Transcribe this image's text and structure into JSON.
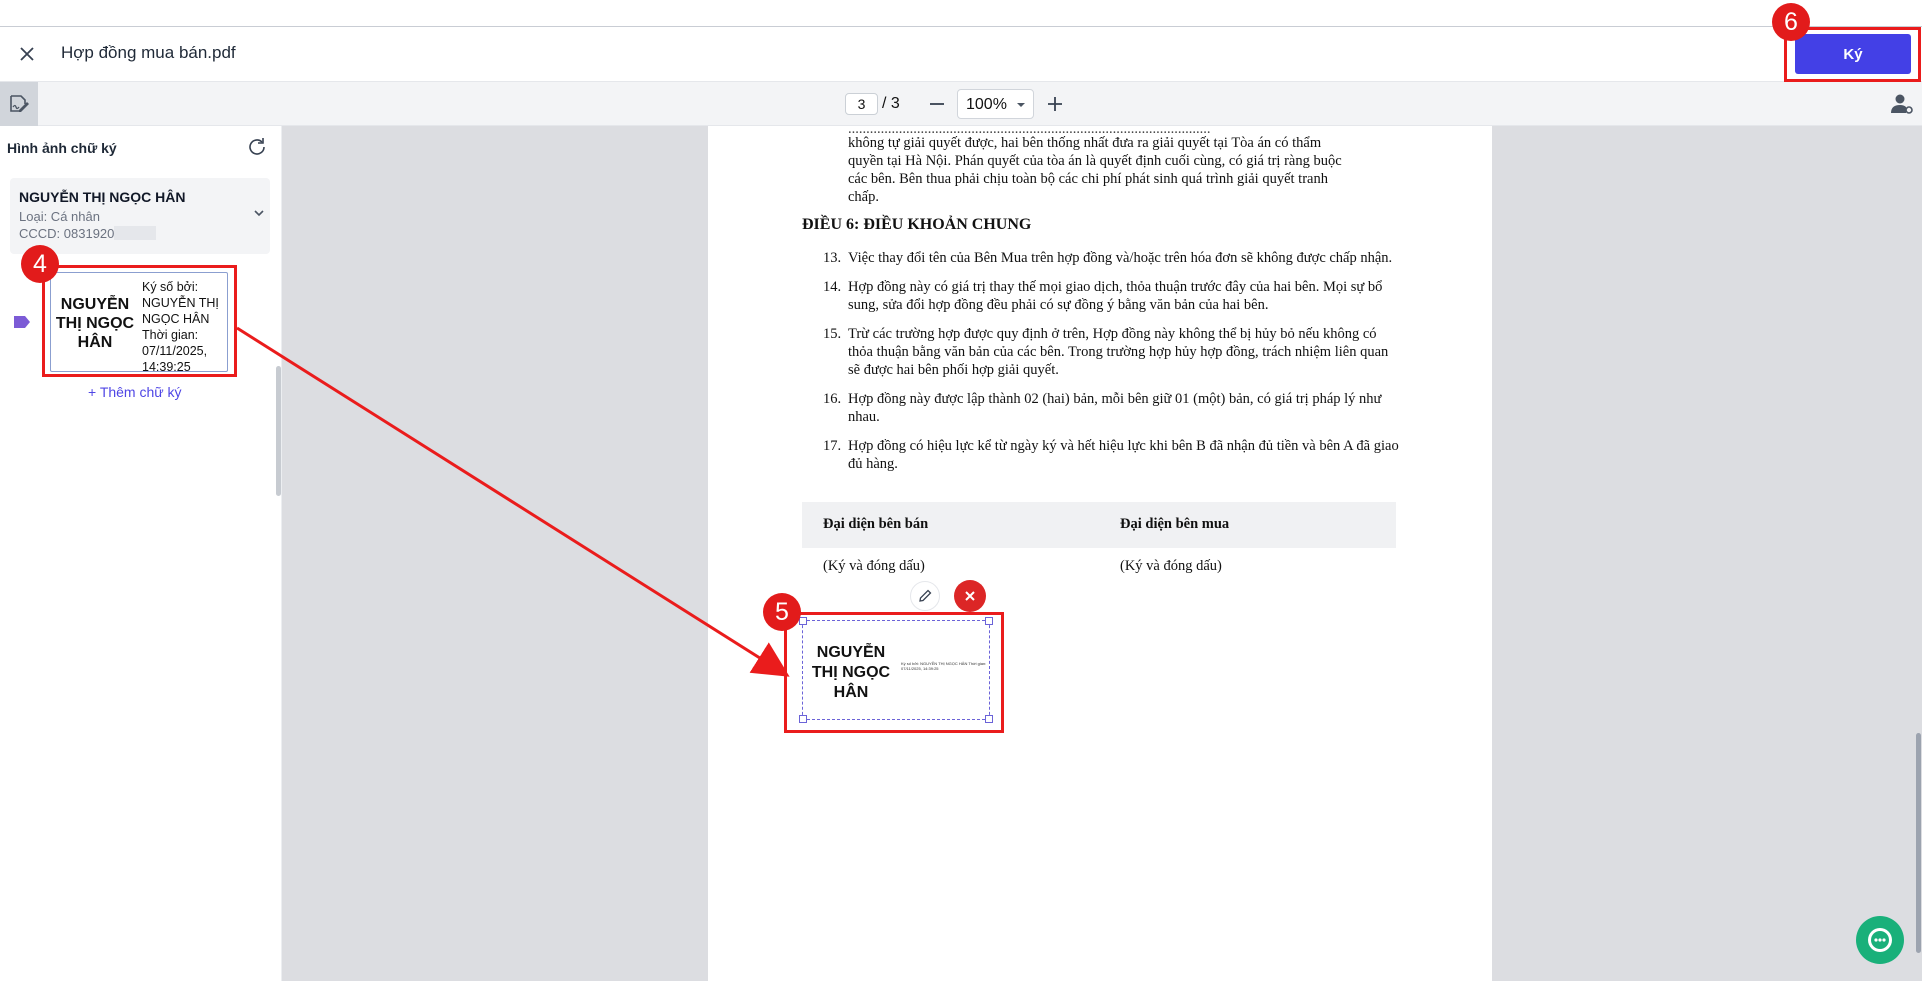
{
  "header": {
    "title": "Hợp đồng mua bán.pdf",
    "sign_label": "Ký"
  },
  "toolbar": {
    "current_page": "3",
    "total_pages": "/ 3",
    "zoom": "100%"
  },
  "sidebar": {
    "title": "Hình ảnh chữ ký",
    "signer": {
      "name": "NGUYỄN THỊ NGỌC HÂN",
      "type": "Loại: Cá nhân",
      "id": "CCCD: 0831920"
    },
    "signature": {
      "name": "NGUYỄN THỊ NGỌC HÂN",
      "info": "Ký số bởi: NGUYỄN THỊ NGỌC HÂN Thời gian: 07/11/2025, 14:39:25"
    },
    "add_label": "+ Thêm chữ ký"
  },
  "document": {
    "top_paragraph": "Trường hợp các bên không tự giải quyết được, hai bên thống nhất đưa ra giải quyết tại Tòa án có thẩm quyền tại Hà Nội. Phán quyết của tòa án là quyết định cuối cùng, có giá trị ràng buộc các bên. Bên thua phải chịu toàn bộ các chi phí phát sinh quá trình giải quyết tranh chấp.",
    "top_line_1": "không tự giải quyết được, hai bên thống nhất đưa ra giải quyết tại Tòa án có thẩm",
    "top_line_2": "quyền tại Hà Nội. Phán quyết của tòa án là quyết định cuối cùng, có giá trị ràng buộc",
    "top_line_3": "các bên. Bên thua phải chịu toàn bộ các chi phí phát sinh quá trình giải quyết tranh",
    "top_line_4": "chấp.",
    "heading": "ĐIỀU 6: ĐIỀU KHOẢN CHUNG",
    "items": [
      {
        "num": "13.",
        "text": "Việc thay đổi tên của Bên Mua trên hợp đồng và/hoặc trên hóa đơn sẽ không được chấp nhận."
      },
      {
        "num": "14.",
        "text": "Hợp đồng này có giá trị thay thế mọi giao dịch, thỏa thuận trước đây của hai bên. Mọi sự bổ sung, sửa đổi hợp đồng đều phải có sự đồng ý bằng văn bản của hai bên."
      },
      {
        "num": "15.",
        "text": "Trừ các trường hợp được quy định ở trên, Hợp đồng này không thể bị hủy bỏ nếu không có thỏa thuận bằng văn bản của các bên. Trong trường hợp hủy hợp đồng, trách nhiệm liên quan sẽ được hai bên phối hợp giải quyết."
      },
      {
        "num": "16.",
        "text": "Hợp đồng này được lập thành 02 (hai) bản, mỗi bên giữ 01 (một) bản, có giá trị pháp lý như nhau."
      },
      {
        "num": "17.",
        "text": "Hợp đồng có hiệu lực kể từ ngày ký và hết hiệu lực khi bên B đã nhận đủ tiền và bên A đã giao đủ hàng."
      }
    ],
    "seller_rep": "Đại diện bên bán",
    "buyer_rep": "Đại diện bên mua",
    "seller_sign_note": "(Ký và đóng dấu)",
    "buyer_sign_note": "(Ký và đóng dấu)",
    "placed_signature": {
      "name": "NGUYỄN THỊ NGỌC HÂN",
      "info": "Ký số bởi: NGUYỄN THỊ NGỌC HÂN Thời gian: 07/11/2025, 14:39:25"
    }
  },
  "annotations": {
    "badge_4": "4",
    "badge_5": "5",
    "badge_6": "6"
  },
  "colors": {
    "accent": "#4340e6",
    "annotation_red": "#ea1c1c",
    "chat": "#19b07a"
  }
}
